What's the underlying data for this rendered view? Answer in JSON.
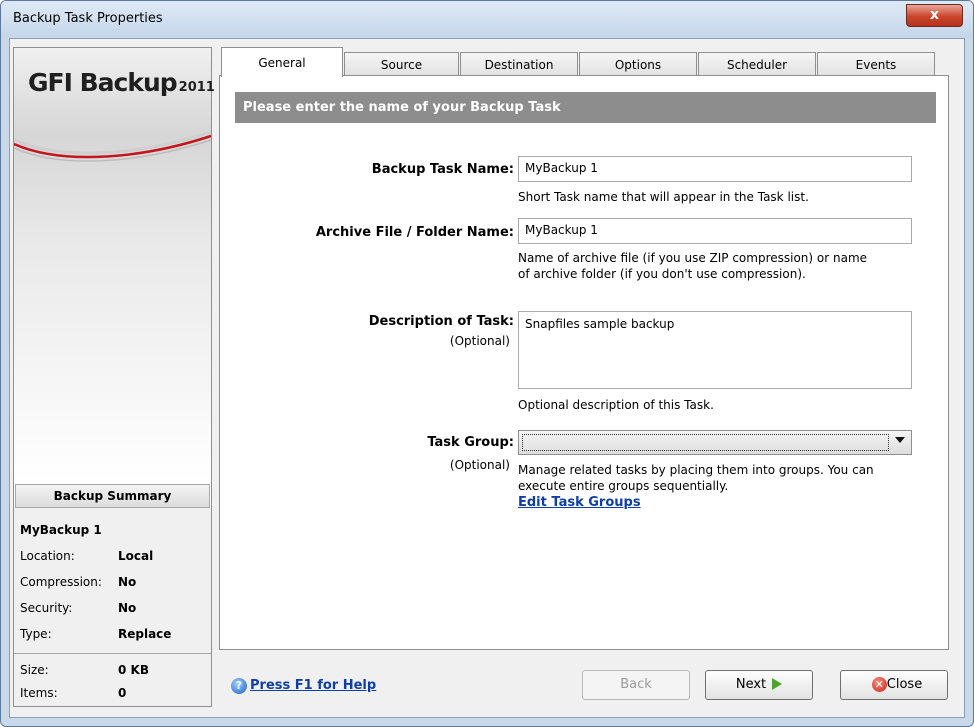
{
  "window": {
    "title": "Backup Task Properties",
    "close_glyph": "x"
  },
  "brand": {
    "logo_text": "GFI Backup",
    "logo_year": "2011",
    "accent_color": "#c4161c"
  },
  "summary": {
    "header": "Backup Summary",
    "task_name": "MyBackup 1",
    "rows": [
      {
        "key": "Location:",
        "value": "Local"
      },
      {
        "key": "Compression:",
        "value": "No"
      },
      {
        "key": "Security:",
        "value": "No"
      },
      {
        "key": "Type:",
        "value": "Replace"
      }
    ],
    "stats": [
      {
        "key": "Size:",
        "value": "0 KB"
      },
      {
        "key": "Items:",
        "value": "0"
      }
    ]
  },
  "tabs": [
    "General",
    "Source",
    "Destination",
    "Options",
    "Scheduler",
    "Events"
  ],
  "active_tab": "General",
  "form": {
    "banner": "Please enter the name of your Backup Task",
    "task_name": {
      "label": "Backup Task Name:",
      "value": "MyBackup 1",
      "hint": "Short Task name that will appear in the Task list."
    },
    "archive_name": {
      "label": "Archive File / Folder Name:",
      "value": "MyBackup 1",
      "hint_line1": "Name of archive file (if you use ZIP compression) or name",
      "hint_line2": "of archive folder (if you don't use compression)."
    },
    "description": {
      "label": "Description of Task:",
      "optional": "(Optional)",
      "value": "Snapfiles sample backup",
      "hint": "Optional description of this Task."
    },
    "task_group": {
      "label": "Task Group:",
      "optional": "(Optional)",
      "value": "",
      "hint_line1": "Manage related tasks by placing them into groups. You can",
      "hint_line2": "execute entire groups sequentially.",
      "edit_link": "Edit Task Groups"
    }
  },
  "footer": {
    "help_link": "Press F1 for Help",
    "help_icon": "help-icon",
    "back": "Back",
    "next": "Next",
    "close": "Close"
  }
}
